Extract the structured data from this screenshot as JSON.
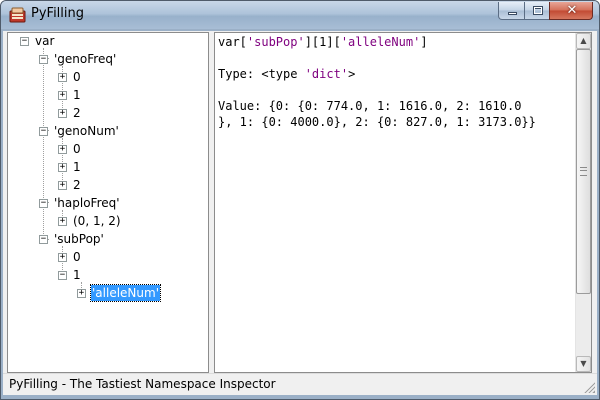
{
  "window": {
    "title": "PyFilling",
    "icon": "pyfilling-app-icon",
    "controls": {
      "minimize": "minimize-icon",
      "maximize": "maximize-icon",
      "close": "close-icon",
      "close_glyph": "✕"
    }
  },
  "tree": {
    "expand_glyph": "+",
    "collapse_glyph": "−",
    "nodes": [
      {
        "label": "var",
        "state": "expanded"
      },
      {
        "label": "'genoFreq'",
        "state": "expanded"
      },
      {
        "label": "0",
        "state": "collapsed"
      },
      {
        "label": "1",
        "state": "collapsed"
      },
      {
        "label": "2",
        "state": "collapsed"
      },
      {
        "label": "'genoNum'",
        "state": "expanded"
      },
      {
        "label": "0",
        "state": "collapsed"
      },
      {
        "label": "1",
        "state": "collapsed"
      },
      {
        "label": "2",
        "state": "collapsed"
      },
      {
        "label": "'haploFreq'",
        "state": "expanded"
      },
      {
        "label": "(0, 1, 2)",
        "state": "collapsed"
      },
      {
        "label": "'subPop'",
        "state": "expanded"
      },
      {
        "label": "0",
        "state": "collapsed"
      },
      {
        "label": "1",
        "state": "expanded"
      },
      {
        "label": "'alleleNum'",
        "state": "collapsed",
        "selected": true
      }
    ]
  },
  "detail": {
    "path": {
      "prefix": "var[",
      "key1": "'subPop'",
      "middle": "][1][",
      "key2": "'alleleNum'",
      "suffix": "]"
    },
    "type": {
      "prefix": "Type: <type ",
      "name": "'dict'",
      "suffix": ">"
    },
    "value_line1": "Value: {0: {0: 774.0, 1: 1616.0, 2: 1610.0",
    "value_line2": "}, 1: {0: 4000.0}, 2: {0: 827.0, 1: 3173.0}}"
  },
  "scrollbar": {
    "up_glyph": "▲",
    "down_glyph": "▼"
  },
  "status": {
    "text": "PyFilling - The Tastiest Namespace Inspector"
  },
  "colors": {
    "selection": "#3399ff",
    "string_literal": "#7f007f",
    "close_button": "#c24a33"
  }
}
